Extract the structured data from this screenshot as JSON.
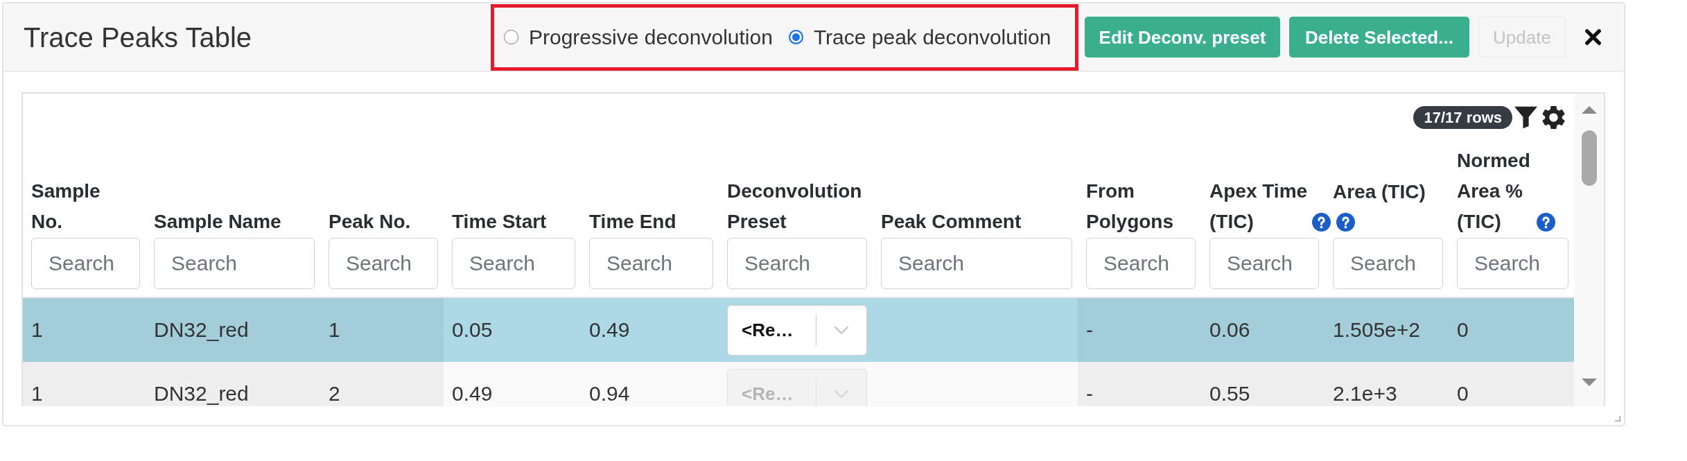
{
  "panel": {
    "title": "Trace Peaks Table"
  },
  "mode_group": {
    "highlighted": true,
    "options": [
      {
        "label": "Progressive deconvolution",
        "selected": false
      },
      {
        "label": "Trace peak deconvolution",
        "selected": true
      }
    ]
  },
  "buttons": [
    {
      "label": "Edit Deconv. preset",
      "disabled": false
    },
    {
      "label": "Delete Selected...",
      "disabled": false
    },
    {
      "label": "Update",
      "disabled": true
    }
  ],
  "table": {
    "row_count": "17/17 rows",
    "columns": [
      {
        "label": "Sample No.",
        "help": false,
        "editable": false,
        "placeholder": "Search"
      },
      {
        "label": "Sample Name",
        "help": false,
        "editable": false,
        "placeholder": "Search"
      },
      {
        "label": "Peak No.",
        "help": false,
        "editable": false,
        "placeholder": "Search"
      },
      {
        "label": "Time Start",
        "help": false,
        "editable": true,
        "placeholder": "Search"
      },
      {
        "label": "Time End",
        "help": false,
        "editable": true,
        "placeholder": "Search"
      },
      {
        "label": "Deconvolution Preset",
        "help": false,
        "editable": true,
        "placeholder": "Search"
      },
      {
        "label": "Peak Comment",
        "help": false,
        "editable": true,
        "placeholder": "Search"
      },
      {
        "label": "From Polygons",
        "help": false,
        "editable": false,
        "placeholder": "Search"
      },
      {
        "label": "Apex Time (TIC)",
        "help": true,
        "editable": false,
        "placeholder": "Search"
      },
      {
        "label": "Area (TIC)",
        "help": true,
        "editable": false,
        "placeholder": "Search"
      },
      {
        "label": "Normed Area % (TIC)",
        "help": true,
        "editable": false,
        "placeholder": "Search"
      }
    ],
    "rows": [
      {
        "selected": true,
        "cells": [
          {
            "kind": "text",
            "text": "1"
          },
          {
            "kind": "text",
            "text": "DN32_red"
          },
          {
            "kind": "text",
            "text": "1"
          },
          {
            "kind": "text",
            "text": "0.05"
          },
          {
            "kind": "text",
            "text": "0.49"
          },
          {
            "kind": "select",
            "value": "<Re…",
            "disabled": false
          },
          {
            "kind": "empty"
          },
          {
            "kind": "text",
            "text": "-"
          },
          {
            "kind": "text",
            "text": "0.06"
          },
          {
            "kind": "text",
            "text": "1.505e+2"
          },
          {
            "kind": "text",
            "text": "0"
          }
        ]
      },
      {
        "selected": false,
        "cells": [
          {
            "kind": "text",
            "text": "1"
          },
          {
            "kind": "text",
            "text": "DN32_red"
          },
          {
            "kind": "text",
            "text": "2"
          },
          {
            "kind": "text",
            "text": "0.49"
          },
          {
            "kind": "text",
            "text": "0.94"
          },
          {
            "kind": "select",
            "value": "<Re…",
            "disabled": true
          },
          {
            "kind": "empty"
          },
          {
            "kind": "text",
            "text": "-"
          },
          {
            "kind": "text",
            "text": "0.55"
          },
          {
            "kind": "text",
            "text": "2.1e+3"
          },
          {
            "kind": "text",
            "text": "0"
          }
        ]
      }
    ]
  }
}
